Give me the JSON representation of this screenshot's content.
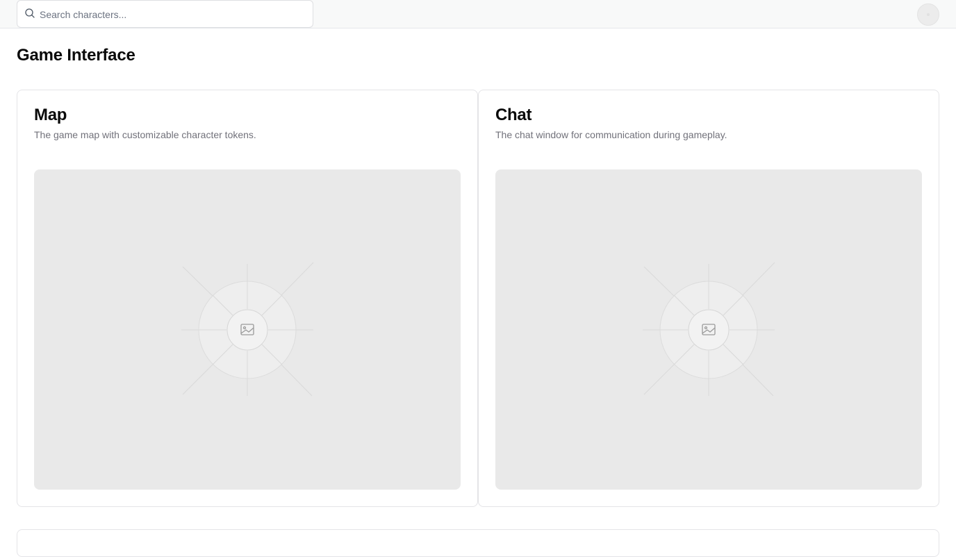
{
  "search": {
    "placeholder": "Search characters...",
    "value": ""
  },
  "page": {
    "title": "Game Interface"
  },
  "cards": [
    {
      "title": "Map",
      "description": "The game map with customizable character tokens."
    },
    {
      "title": "Chat",
      "description": "The chat window for communication during gameplay."
    }
  ],
  "icons": {
    "search": "search-icon",
    "image": "image-placeholder-icon",
    "avatar": "user-avatar"
  },
  "colors": {
    "topbar_bg": "#f8f9f9",
    "placeholder_bg": "#e9e9e9",
    "muted_text": "#71717a",
    "border": "#e4e4e7"
  }
}
